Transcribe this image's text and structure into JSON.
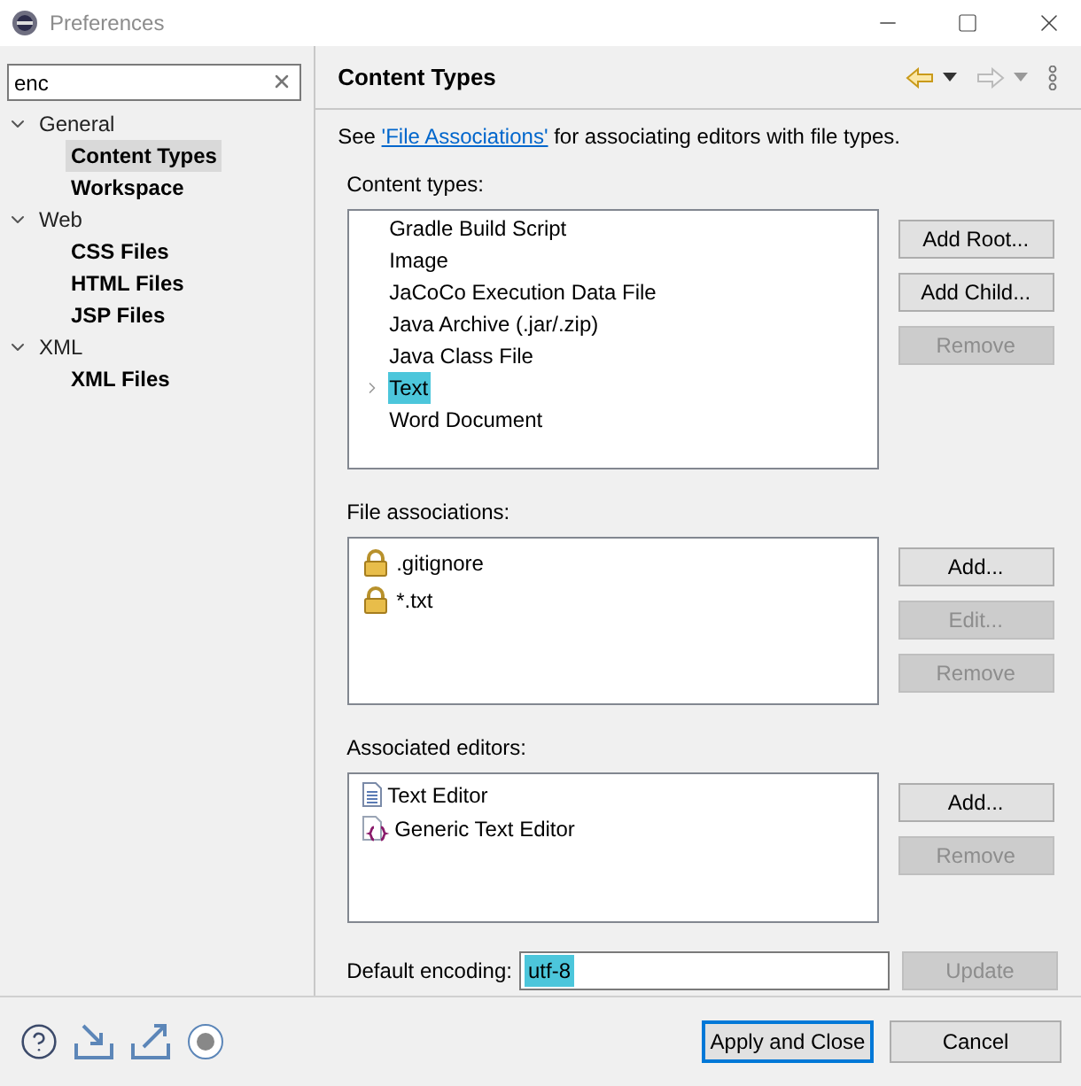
{
  "window": {
    "title": "Preferences"
  },
  "filter": {
    "value": "enc"
  },
  "tree": [
    {
      "label": "General",
      "expanded": true,
      "children": [
        {
          "label": "Content Types",
          "selected": true
        },
        {
          "label": "Workspace",
          "selected": false
        }
      ]
    },
    {
      "label": "Web",
      "expanded": true,
      "children": [
        {
          "label": "CSS Files",
          "selected": false
        },
        {
          "label": "HTML Files",
          "selected": false
        },
        {
          "label": "JSP Files",
          "selected": false
        }
      ]
    },
    {
      "label": "XML",
      "expanded": true,
      "children": [
        {
          "label": "XML Files",
          "selected": false
        }
      ]
    }
  ],
  "page": {
    "title": "Content Types",
    "intro_before": "See ",
    "intro_link": "'File Associations'",
    "intro_after": " for associating editors with file types."
  },
  "content_types": {
    "label": "Content types:",
    "items": [
      {
        "label": "Gradle Build Script",
        "selected": false,
        "has_children": false
      },
      {
        "label": "Image",
        "selected": false,
        "has_children": false
      },
      {
        "label": "JaCoCo Execution Data File",
        "selected": false,
        "has_children": false
      },
      {
        "label": "Java Archive (.jar/.zip)",
        "selected": false,
        "has_children": false
      },
      {
        "label": "Java Class File",
        "selected": false,
        "has_children": false
      },
      {
        "label": "Text",
        "selected": true,
        "has_children": true
      },
      {
        "label": "Word Document",
        "selected": false,
        "has_children": false
      }
    ],
    "buttons": [
      {
        "label": "Add Root...",
        "disabled": false
      },
      {
        "label": "Add Child...",
        "disabled": false
      },
      {
        "label": "Remove",
        "disabled": true
      }
    ]
  },
  "file_associations": {
    "label": "File associations:",
    "items": [
      {
        "label": ".gitignore"
      },
      {
        "label": "*.txt"
      }
    ],
    "buttons": [
      {
        "label": "Add...",
        "disabled": false
      },
      {
        "label": "Edit...",
        "disabled": true
      },
      {
        "label": "Remove",
        "disabled": true
      }
    ]
  },
  "associated_editors": {
    "label": "Associated editors:",
    "items": [
      {
        "label": "Text Editor",
        "kind": "text"
      },
      {
        "label": "Generic Text Editor",
        "kind": "generic"
      }
    ],
    "buttons": [
      {
        "label": "Add...",
        "disabled": false
      },
      {
        "label": "Remove",
        "disabled": true
      }
    ]
  },
  "encoding": {
    "label": "Default encoding:",
    "value": "utf-8",
    "highlighted": true,
    "button": {
      "label": "Update",
      "disabled": true
    }
  },
  "footer": {
    "buttons": [
      {
        "label": "Apply and Close",
        "default": true
      },
      {
        "label": "Cancel",
        "default": false
      }
    ]
  }
}
